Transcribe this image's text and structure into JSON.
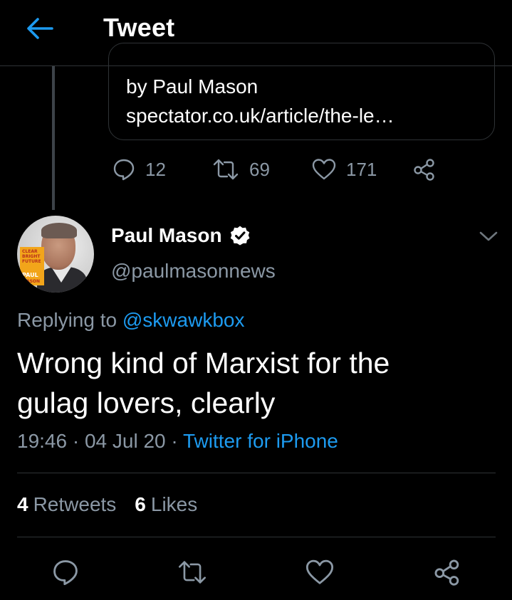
{
  "header": {
    "title": "Tweet"
  },
  "quoted_card": {
    "author_line": "by Paul Mason",
    "url": "spectator.co.uk/article/the-le…"
  },
  "quoted_actions": {
    "replies": "12",
    "retweets": "69",
    "likes": "171"
  },
  "avatar_book": [
    "CLEAR",
    "BRIGHT",
    "FUTURE",
    "PAUL",
    "MASON"
  ],
  "tweet": {
    "author_name": "Paul Mason",
    "handle": "@paulmasonnews",
    "replying_prefix": "Replying to ",
    "replying_to": "@skwawkbox",
    "text_line1": "Wrong kind of Marxist for the",
    "text_line2": "gulag lovers, clearly",
    "time": "19:46",
    "date": "04 Jul 20",
    "separator": " · ",
    "source": "Twitter for iPhone"
  },
  "stats": {
    "retweets_count": "4",
    "retweets_label": "Retweets",
    "likes_count": "6",
    "likes_label": "Likes"
  },
  "colors": {
    "background": "#000000",
    "accent": "#1d9bf0",
    "secondary_text": "#8b98a5",
    "divider": "#2f3336",
    "verified_badge": "#ffffff"
  }
}
